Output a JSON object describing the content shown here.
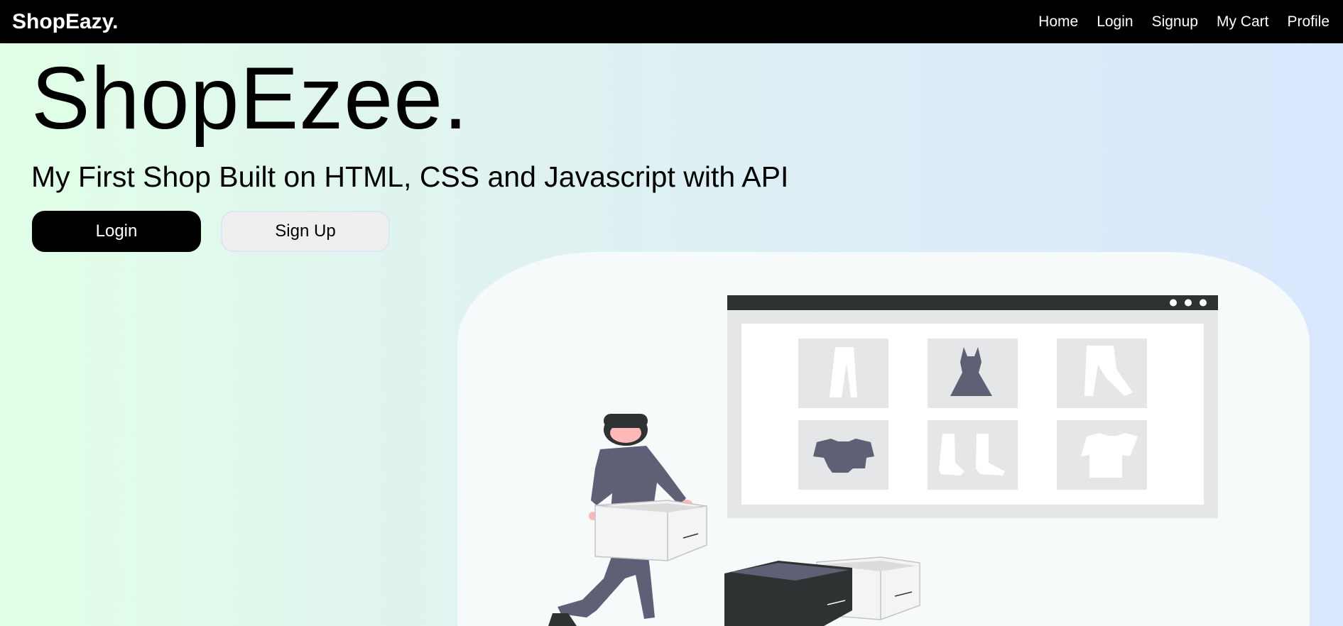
{
  "navbar": {
    "brand": "ShopEazy.",
    "links": [
      "Home",
      "Login",
      "Signup",
      "My Cart",
      "Profile"
    ]
  },
  "hero": {
    "title": "ShopEzee.",
    "subtitle": "My First Shop Built on HTML, CSS and Javascript with API",
    "login_label": "Login",
    "signup_label": "Sign Up"
  },
  "colors": {
    "navbar_bg": "#000000",
    "login_button_bg": "#000000",
    "signup_button_bg": "#efefef",
    "illustration_dark": "#2f3233",
    "illustration_purple": "#5f5f76",
    "illustration_skin": "#ffb8b8"
  },
  "illustration": {
    "icons": [
      "pants-icon",
      "dress-icon",
      "trousers-icon",
      "crop-top-icon",
      "boots-icon",
      "tshirt-icon"
    ]
  }
}
